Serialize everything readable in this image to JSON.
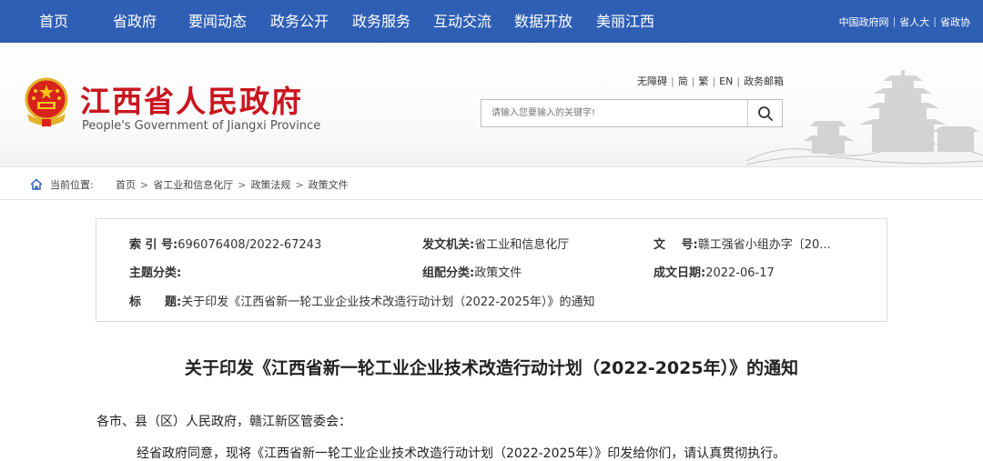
{
  "nav": {
    "items": [
      {
        "label": "首页"
      },
      {
        "label": "省政府"
      },
      {
        "label": "要闻动态"
      },
      {
        "label": "政务公开"
      },
      {
        "label": "政务服务"
      },
      {
        "label": "互动交流"
      },
      {
        "label": "数据开放"
      },
      {
        "label": "美丽江西"
      }
    ],
    "links": [
      "中国政府网",
      "省人大",
      "省政协"
    ],
    "link_separator": "|"
  },
  "header": {
    "title": "江西省人民政府",
    "subtitle": "People's Government of Jiangxi Province",
    "util_links": [
      "无障碍",
      "简",
      "繁",
      "EN",
      "政务邮箱"
    ],
    "util_separator": "|",
    "search_placeholder": "请输入您要输入的关键字!"
  },
  "breadcrumb": {
    "label": "当前位置:",
    "items": [
      "首页",
      "省工业和信息化厅",
      "政策法规",
      "政策文件"
    ],
    "arrow": ">"
  },
  "info": {
    "index_label": "索 引 号:",
    "index_value": "696076408/2022-67243",
    "issuer_label": "发文机关:",
    "issuer_value": "省工业和信息化厅",
    "docno_label": "文　 号:",
    "docno_value": "赣工强省小组办字〔20...",
    "topic_label": "主题分类:",
    "topic_value": "",
    "category_label": "组配分类:",
    "category_value": "政策文件",
    "date_label": "成文日期:",
    "date_value": "2022-06-17",
    "title_label": "标　　题:",
    "title_value": "关于印发《江西省新一轮工业企业技术改造行动计划（2022-2025年）》的通知"
  },
  "article": {
    "title": "关于印发《江西省新一轮工业企业技术改造行动计划（2022-2025年）》的通知",
    "paragraphs": [
      "各市、县（区）人民政府，赣江新区管委会：",
      "经省政府同意，现将《江西省新一轮工业企业技术改造行动计划（2022-2025年）》印发给你们，请认真贯彻执行。"
    ]
  },
  "colors": {
    "nav_bg": "#2f5fb5",
    "title_red": "#c9151e"
  }
}
